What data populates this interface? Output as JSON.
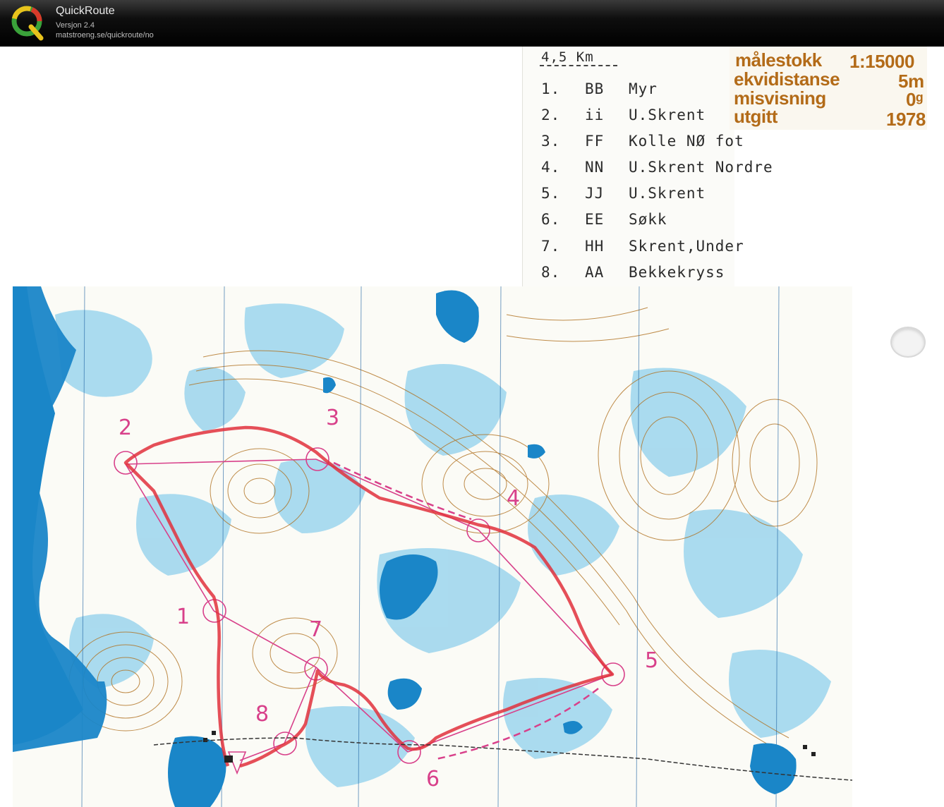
{
  "app": {
    "title": "QuickRoute",
    "version": "Versjon 2.4",
    "url": "matstroeng.se/quickroute/no"
  },
  "course": {
    "length": "4,5 Km",
    "controls": [
      {
        "num": "1.",
        "code": "BB",
        "desc": "Myr"
      },
      {
        "num": "2.",
        "code": "ii",
        "desc": "U.Skrent"
      },
      {
        "num": "3.",
        "code": "FF",
        "desc": "Kolle NØ fot"
      },
      {
        "num": "4.",
        "code": "NN",
        "desc": "U.Skrent Nordre"
      },
      {
        "num": "5.",
        "code": "JJ",
        "desc": "U.Skrent"
      },
      {
        "num": "6.",
        "code": "EE",
        "desc": "Søkk"
      },
      {
        "num": "7.",
        "code": "HH",
        "desc": "Skrent,Under"
      },
      {
        "num": "8.",
        "code": "AA",
        "desc": "Bekkekryss"
      }
    ]
  },
  "map_info": {
    "scale_label": "målestokk",
    "scale_value": "1:15000",
    "contour_label": "ekvidistanse",
    "contour_value": "5m",
    "declination_label": "misvisning",
    "declination_value": "0ᵍ",
    "published_label": "utgitt",
    "published_value": "1978"
  },
  "map_markings": {
    "control_numbers": [
      "1",
      "2",
      "3",
      "4",
      "5",
      "6",
      "7",
      "8"
    ]
  },
  "colors": {
    "water": "#1a86c8",
    "marsh": "#8fd0ec",
    "contour": "#b0701e",
    "route": "#e0303c",
    "course": "#d8408a",
    "paper": "#fbfbf6"
  }
}
